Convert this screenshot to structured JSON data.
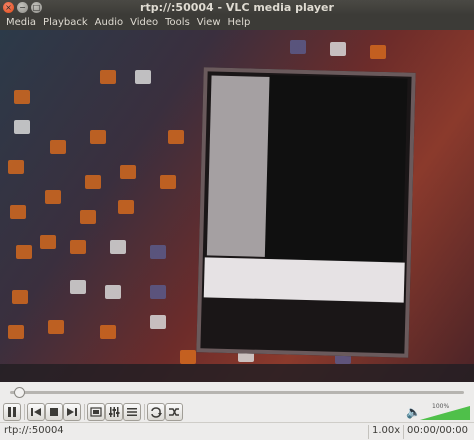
{
  "window": {
    "title": "rtp://:50004 - VLC media player",
    "buttons": {
      "close": "×",
      "minimize": "−",
      "maximize": "□"
    }
  },
  "menu": {
    "items": [
      "Media",
      "Playback",
      "Audio",
      "Video",
      "Tools",
      "View",
      "Help"
    ]
  },
  "player": {
    "seek_position": 0.02,
    "volume_percent": "100%",
    "volume_level": 1.0
  },
  "controls": {
    "pause": "pause-icon",
    "previous": "skip-back-icon",
    "stop": "stop-icon",
    "next": "skip-forward-icon",
    "fullscreen": "fullscreen-icon",
    "playlist": "playlist-icon",
    "extended": "equalizer-icon",
    "loop": "loop-icon",
    "shuffle": "shuffle-icon"
  },
  "status": {
    "url": "rtp://:50004",
    "speed": "1.00x",
    "time": "00:00/00:00"
  },
  "colors": {
    "chrome_dark": "#3c3b37",
    "chrome_light": "#edeceb",
    "close_button": "#df4a16",
    "volume_fill": "#4fc04a"
  }
}
